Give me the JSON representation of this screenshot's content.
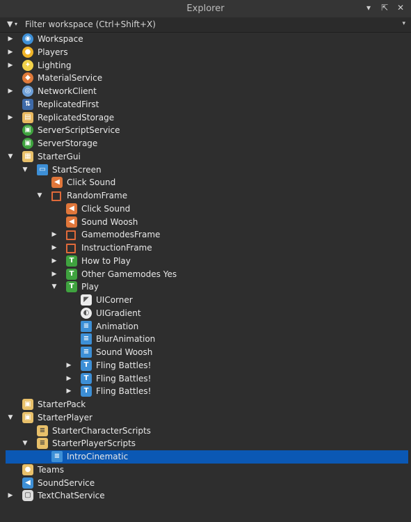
{
  "panel": {
    "title": "Explorer",
    "icons": [
      "dropdown-icon",
      "undock-icon",
      "close-icon"
    ]
  },
  "filter": {
    "placeholder": "Filter workspace (Ctrl+Shift+X)"
  },
  "colors": {
    "background": "#2e2e2e",
    "selection": "#0b58b4",
    "frame": "#e06a3a",
    "sound": "#e0763a",
    "textbutton": "#3fa33f",
    "script": "#3d8fd6",
    "folder": "#e8c06a"
  },
  "tree": [
    {
      "label": "Workspace",
      "icon": "workspace-icon",
      "caret": "collapsed",
      "depth": 0
    },
    {
      "label": "Players",
      "icon": "players-icon",
      "caret": "collapsed",
      "depth": 0
    },
    {
      "label": "Lighting",
      "icon": "lighting-icon",
      "caret": "collapsed",
      "depth": 0
    },
    {
      "label": "MaterialService",
      "icon": "material-service-icon",
      "caret": "none",
      "depth": 0
    },
    {
      "label": "NetworkClient",
      "icon": "network-client-icon",
      "caret": "collapsed",
      "depth": 0
    },
    {
      "label": "ReplicatedFirst",
      "icon": "replicated-first-icon",
      "caret": "none",
      "depth": 0
    },
    {
      "label": "ReplicatedStorage",
      "icon": "replicated-storage-icon",
      "caret": "collapsed",
      "depth": 0
    },
    {
      "label": "ServerScriptService",
      "icon": "server-script-service-icon",
      "caret": "none",
      "depth": 0
    },
    {
      "label": "ServerStorage",
      "icon": "server-storage-icon",
      "caret": "none",
      "depth": 0
    },
    {
      "label": "StarterGui",
      "icon": "starter-gui-icon",
      "caret": "expanded",
      "depth": 0
    },
    {
      "label": "StartScreen",
      "icon": "screengui-icon",
      "caret": "expanded",
      "depth": 1
    },
    {
      "label": "Click Sound",
      "icon": "sound-icon",
      "caret": "none",
      "depth": 2
    },
    {
      "label": "RandomFrame",
      "icon": "frame-icon",
      "caret": "expanded",
      "depth": 2
    },
    {
      "label": "Click Sound",
      "icon": "sound-icon",
      "caret": "none",
      "depth": 3
    },
    {
      "label": "Sound Woosh",
      "icon": "sound-icon",
      "caret": "none",
      "depth": 3
    },
    {
      "label": "GamemodesFrame",
      "icon": "frame-icon",
      "caret": "collapsed",
      "depth": 3
    },
    {
      "label": "InstructionFrame",
      "icon": "frame-icon",
      "caret": "collapsed",
      "depth": 3
    },
    {
      "label": "How to Play",
      "icon": "textbutton-icon",
      "caret": "collapsed",
      "depth": 3
    },
    {
      "label": "Other Gamemodes Yes",
      "icon": "textbutton-icon",
      "caret": "collapsed",
      "depth": 3
    },
    {
      "label": "Play",
      "icon": "textbutton-icon",
      "caret": "expanded",
      "depth": 3
    },
    {
      "label": "UICorner",
      "icon": "uicorner-icon",
      "caret": "none",
      "depth": 4
    },
    {
      "label": "UIGradient",
      "icon": "uigradient-icon",
      "caret": "none",
      "depth": 4
    },
    {
      "label": "Animation",
      "icon": "localscript-icon",
      "caret": "none",
      "depth": 4
    },
    {
      "label": "BlurAnimation",
      "icon": "localscript-icon",
      "caret": "none",
      "depth": 4
    },
    {
      "label": "Sound Woosh",
      "icon": "localscript-icon",
      "caret": "none",
      "depth": 4
    },
    {
      "label": "Fling Battles!",
      "icon": "textlabel-icon",
      "caret": "collapsed",
      "depth": 4
    },
    {
      "label": "Fling Battles!",
      "icon": "textlabel-icon",
      "caret": "collapsed",
      "depth": 4
    },
    {
      "label": "Fling Battles!",
      "icon": "textlabel-icon",
      "caret": "collapsed",
      "depth": 4
    },
    {
      "label": "StarterPack",
      "icon": "starter-pack-icon",
      "caret": "none",
      "depth": 0
    },
    {
      "label": "StarterPlayer",
      "icon": "starter-player-icon",
      "caret": "expanded",
      "depth": 0
    },
    {
      "label": "StarterCharacterScripts",
      "icon": "starter-scripts-folder-icon",
      "caret": "none",
      "depth": 1
    },
    {
      "label": "StarterPlayerScripts",
      "icon": "starter-scripts-folder-icon",
      "caret": "expanded",
      "depth": 1
    },
    {
      "label": "IntroCinematic",
      "icon": "localscript-icon",
      "caret": "none",
      "depth": 2,
      "selected": true
    },
    {
      "label": "Teams",
      "icon": "teams-icon",
      "caret": "none",
      "depth": 0
    },
    {
      "label": "SoundService",
      "icon": "sound-service-icon",
      "caret": "none",
      "depth": 0
    },
    {
      "label": "TextChatService",
      "icon": "text-chat-service-icon",
      "caret": "collapsed",
      "depth": 0
    }
  ]
}
